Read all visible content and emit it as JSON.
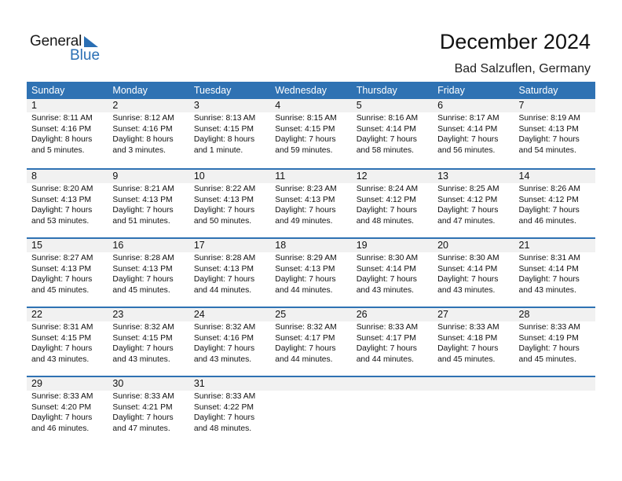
{
  "logo": {
    "general": "General",
    "blue": "Blue"
  },
  "header": {
    "title": "December 2024",
    "location": "Bad Salzuflen, Germany"
  },
  "colors": {
    "accent": "#2f72b3",
    "date_row_bg": "#f1f1f1"
  },
  "weekdays": [
    "Sunday",
    "Monday",
    "Tuesday",
    "Wednesday",
    "Thursday",
    "Friday",
    "Saturday"
  ],
  "weeks": [
    [
      {
        "day": "1",
        "sunrise": "Sunrise: 8:11 AM",
        "sunset": "Sunset: 4:16 PM",
        "daylight1": "Daylight: 8 hours",
        "daylight2": "and 5 minutes."
      },
      {
        "day": "2",
        "sunrise": "Sunrise: 8:12 AM",
        "sunset": "Sunset: 4:16 PM",
        "daylight1": "Daylight: 8 hours",
        "daylight2": "and 3 minutes."
      },
      {
        "day": "3",
        "sunrise": "Sunrise: 8:13 AM",
        "sunset": "Sunset: 4:15 PM",
        "daylight1": "Daylight: 8 hours",
        "daylight2": "and 1 minute."
      },
      {
        "day": "4",
        "sunrise": "Sunrise: 8:15 AM",
        "sunset": "Sunset: 4:15 PM",
        "daylight1": "Daylight: 7 hours",
        "daylight2": "and 59 minutes."
      },
      {
        "day": "5",
        "sunrise": "Sunrise: 8:16 AM",
        "sunset": "Sunset: 4:14 PM",
        "daylight1": "Daylight: 7 hours",
        "daylight2": "and 58 minutes."
      },
      {
        "day": "6",
        "sunrise": "Sunrise: 8:17 AM",
        "sunset": "Sunset: 4:14 PM",
        "daylight1": "Daylight: 7 hours",
        "daylight2": "and 56 minutes."
      },
      {
        "day": "7",
        "sunrise": "Sunrise: 8:19 AM",
        "sunset": "Sunset: 4:13 PM",
        "daylight1": "Daylight: 7 hours",
        "daylight2": "and 54 minutes."
      }
    ],
    [
      {
        "day": "8",
        "sunrise": "Sunrise: 8:20 AM",
        "sunset": "Sunset: 4:13 PM",
        "daylight1": "Daylight: 7 hours",
        "daylight2": "and 53 minutes."
      },
      {
        "day": "9",
        "sunrise": "Sunrise: 8:21 AM",
        "sunset": "Sunset: 4:13 PM",
        "daylight1": "Daylight: 7 hours",
        "daylight2": "and 51 minutes."
      },
      {
        "day": "10",
        "sunrise": "Sunrise: 8:22 AM",
        "sunset": "Sunset: 4:13 PM",
        "daylight1": "Daylight: 7 hours",
        "daylight2": "and 50 minutes."
      },
      {
        "day": "11",
        "sunrise": "Sunrise: 8:23 AM",
        "sunset": "Sunset: 4:13 PM",
        "daylight1": "Daylight: 7 hours",
        "daylight2": "and 49 minutes."
      },
      {
        "day": "12",
        "sunrise": "Sunrise: 8:24 AM",
        "sunset": "Sunset: 4:12 PM",
        "daylight1": "Daylight: 7 hours",
        "daylight2": "and 48 minutes."
      },
      {
        "day": "13",
        "sunrise": "Sunrise: 8:25 AM",
        "sunset": "Sunset: 4:12 PM",
        "daylight1": "Daylight: 7 hours",
        "daylight2": "and 47 minutes."
      },
      {
        "day": "14",
        "sunrise": "Sunrise: 8:26 AM",
        "sunset": "Sunset: 4:12 PM",
        "daylight1": "Daylight: 7 hours",
        "daylight2": "and 46 minutes."
      }
    ],
    [
      {
        "day": "15",
        "sunrise": "Sunrise: 8:27 AM",
        "sunset": "Sunset: 4:13 PM",
        "daylight1": "Daylight: 7 hours",
        "daylight2": "and 45 minutes."
      },
      {
        "day": "16",
        "sunrise": "Sunrise: 8:28 AM",
        "sunset": "Sunset: 4:13 PM",
        "daylight1": "Daylight: 7 hours",
        "daylight2": "and 45 minutes."
      },
      {
        "day": "17",
        "sunrise": "Sunrise: 8:28 AM",
        "sunset": "Sunset: 4:13 PM",
        "daylight1": "Daylight: 7 hours",
        "daylight2": "and 44 minutes."
      },
      {
        "day": "18",
        "sunrise": "Sunrise: 8:29 AM",
        "sunset": "Sunset: 4:13 PM",
        "daylight1": "Daylight: 7 hours",
        "daylight2": "and 44 minutes."
      },
      {
        "day": "19",
        "sunrise": "Sunrise: 8:30 AM",
        "sunset": "Sunset: 4:14 PM",
        "daylight1": "Daylight: 7 hours",
        "daylight2": "and 43 minutes."
      },
      {
        "day": "20",
        "sunrise": "Sunrise: 8:30 AM",
        "sunset": "Sunset: 4:14 PM",
        "daylight1": "Daylight: 7 hours",
        "daylight2": "and 43 minutes."
      },
      {
        "day": "21",
        "sunrise": "Sunrise: 8:31 AM",
        "sunset": "Sunset: 4:14 PM",
        "daylight1": "Daylight: 7 hours",
        "daylight2": "and 43 minutes."
      }
    ],
    [
      {
        "day": "22",
        "sunrise": "Sunrise: 8:31 AM",
        "sunset": "Sunset: 4:15 PM",
        "daylight1": "Daylight: 7 hours",
        "daylight2": "and 43 minutes."
      },
      {
        "day": "23",
        "sunrise": "Sunrise: 8:32 AM",
        "sunset": "Sunset: 4:15 PM",
        "daylight1": "Daylight: 7 hours",
        "daylight2": "and 43 minutes."
      },
      {
        "day": "24",
        "sunrise": "Sunrise: 8:32 AM",
        "sunset": "Sunset: 4:16 PM",
        "daylight1": "Daylight: 7 hours",
        "daylight2": "and 43 minutes."
      },
      {
        "day": "25",
        "sunrise": "Sunrise: 8:32 AM",
        "sunset": "Sunset: 4:17 PM",
        "daylight1": "Daylight: 7 hours",
        "daylight2": "and 44 minutes."
      },
      {
        "day": "26",
        "sunrise": "Sunrise: 8:33 AM",
        "sunset": "Sunset: 4:17 PM",
        "daylight1": "Daylight: 7 hours",
        "daylight2": "and 44 minutes."
      },
      {
        "day": "27",
        "sunrise": "Sunrise: 8:33 AM",
        "sunset": "Sunset: 4:18 PM",
        "daylight1": "Daylight: 7 hours",
        "daylight2": "and 45 minutes."
      },
      {
        "day": "28",
        "sunrise": "Sunrise: 8:33 AM",
        "sunset": "Sunset: 4:19 PM",
        "daylight1": "Daylight: 7 hours",
        "daylight2": "and 45 minutes."
      }
    ],
    [
      {
        "day": "29",
        "sunrise": "Sunrise: 8:33 AM",
        "sunset": "Sunset: 4:20 PM",
        "daylight1": "Daylight: 7 hours",
        "daylight2": "and 46 minutes."
      },
      {
        "day": "30",
        "sunrise": "Sunrise: 8:33 AM",
        "sunset": "Sunset: 4:21 PM",
        "daylight1": "Daylight: 7 hours",
        "daylight2": "and 47 minutes."
      },
      {
        "day": "31",
        "sunrise": "Sunrise: 8:33 AM",
        "sunset": "Sunset: 4:22 PM",
        "daylight1": "Daylight: 7 hours",
        "daylight2": "and 48 minutes."
      },
      {
        "day": "",
        "sunrise": "",
        "sunset": "",
        "daylight1": "",
        "daylight2": ""
      },
      {
        "day": "",
        "sunrise": "",
        "sunset": "",
        "daylight1": "",
        "daylight2": ""
      },
      {
        "day": "",
        "sunrise": "",
        "sunset": "",
        "daylight1": "",
        "daylight2": ""
      },
      {
        "day": "",
        "sunrise": "",
        "sunset": "",
        "daylight1": "",
        "daylight2": ""
      }
    ]
  ]
}
